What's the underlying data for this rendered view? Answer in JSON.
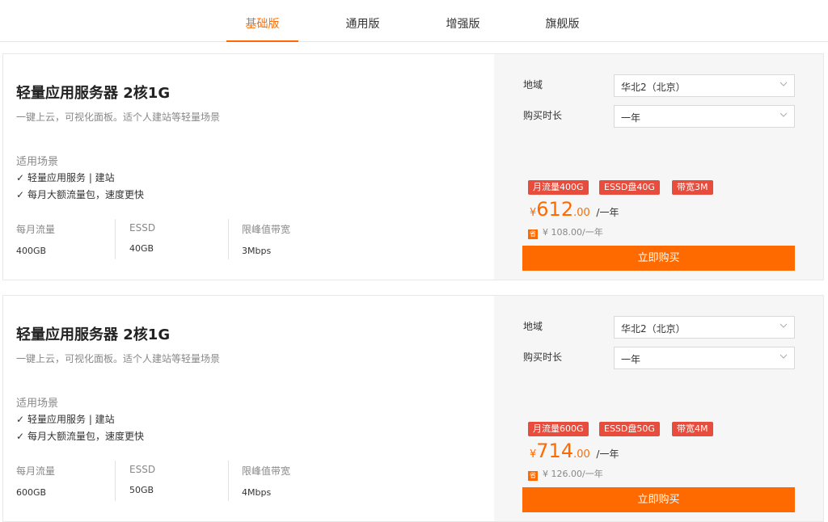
{
  "tabs": [
    {
      "label": "基础版",
      "active": true
    },
    {
      "label": "通用版",
      "active": false
    },
    {
      "label": "增强版",
      "active": false
    },
    {
      "label": "旗舰版",
      "active": false
    }
  ],
  "cards": [
    {
      "title": "轻量应用服务器 2核1G",
      "subtitle": "一键上云，可视化面板。适个人建站等轻量场景",
      "scene_title": "适用场景",
      "features": [
        "轻量应用服务 | 建站",
        "每月大额流量包，速度更快"
      ],
      "specs": [
        {
          "label": "每月流量",
          "value": "400GB"
        },
        {
          "label": "ESSD",
          "value": "40GB"
        },
        {
          "label": "限峰值带宽",
          "value": "3Mbps"
        }
      ],
      "region_label": "地域",
      "region_value": "华北2（北京）",
      "duration_label": "购买时长",
      "duration_value": "一年",
      "tags": [
        "月流量400G",
        "ESSD盘40G",
        "带宽3M"
      ],
      "price_currency": "¥",
      "price_integer": "612",
      "price_decimal": ".00",
      "price_unit": "/一年",
      "save_badge": "省",
      "save_amount": "¥ 108.00",
      "save_unit": "/一年",
      "buy_label": "立即购买"
    },
    {
      "title": "轻量应用服务器 2核1G",
      "subtitle": "一键上云，可视化面板。适个人建站等轻量场景",
      "scene_title": "适用场景",
      "features": [
        "轻量应用服务 | 建站",
        "每月大额流量包，速度更快"
      ],
      "specs": [
        {
          "label": "每月流量",
          "value": "600GB"
        },
        {
          "label": "ESSD",
          "value": "50GB"
        },
        {
          "label": "限峰值带宽",
          "value": "4Mbps"
        }
      ],
      "region_label": "地域",
      "region_value": "华北2（北京）",
      "duration_label": "购买时长",
      "duration_value": "一年",
      "tags": [
        "月流量600G",
        "ESSD盘50G",
        "带宽4M"
      ],
      "price_currency": "¥",
      "price_integer": "714",
      "price_decimal": ".00",
      "price_unit": "/一年",
      "save_badge": "省",
      "save_amount": "¥ 126.00",
      "save_unit": "/一年",
      "buy_label": "立即购买"
    }
  ],
  "colors": {
    "accent": "#ff6a00",
    "tag": "#e74c3c"
  }
}
